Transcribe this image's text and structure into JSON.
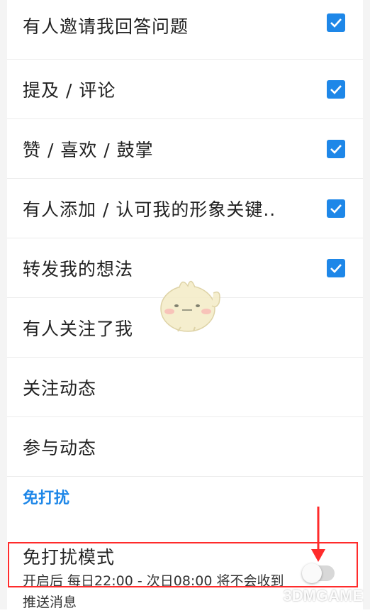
{
  "notification_items": [
    {
      "label": "有人邀请我回答问题",
      "checked": true
    },
    {
      "label": "提及 / 评论",
      "checked": true
    },
    {
      "label": "赞 / 喜欢 / 鼓掌",
      "checked": true
    },
    {
      "label": "有人添加 / 认可我的形象关键..",
      "checked": true
    },
    {
      "label": "转发我的想法",
      "checked": true
    },
    {
      "label": "有人关注了我",
      "checked": false
    },
    {
      "label": "关注动态",
      "checked": false
    },
    {
      "label": "参与动态",
      "checked": false
    }
  ],
  "dnd_section": {
    "header": "免打扰",
    "title": "免打扰模式",
    "description": "开启后 每日22:00 - 次日08:00 将不会收到推送消息",
    "enabled": false
  },
  "watermark": "3DMGAME",
  "colors": {
    "accent": "#1e87e8",
    "highlight": "#ff2b2b",
    "divider": "#ececec"
  },
  "icons": {
    "checkbox": "checkmark-icon",
    "mascot": "chick-mascot-icon",
    "arrow": "down-arrow-icon"
  }
}
